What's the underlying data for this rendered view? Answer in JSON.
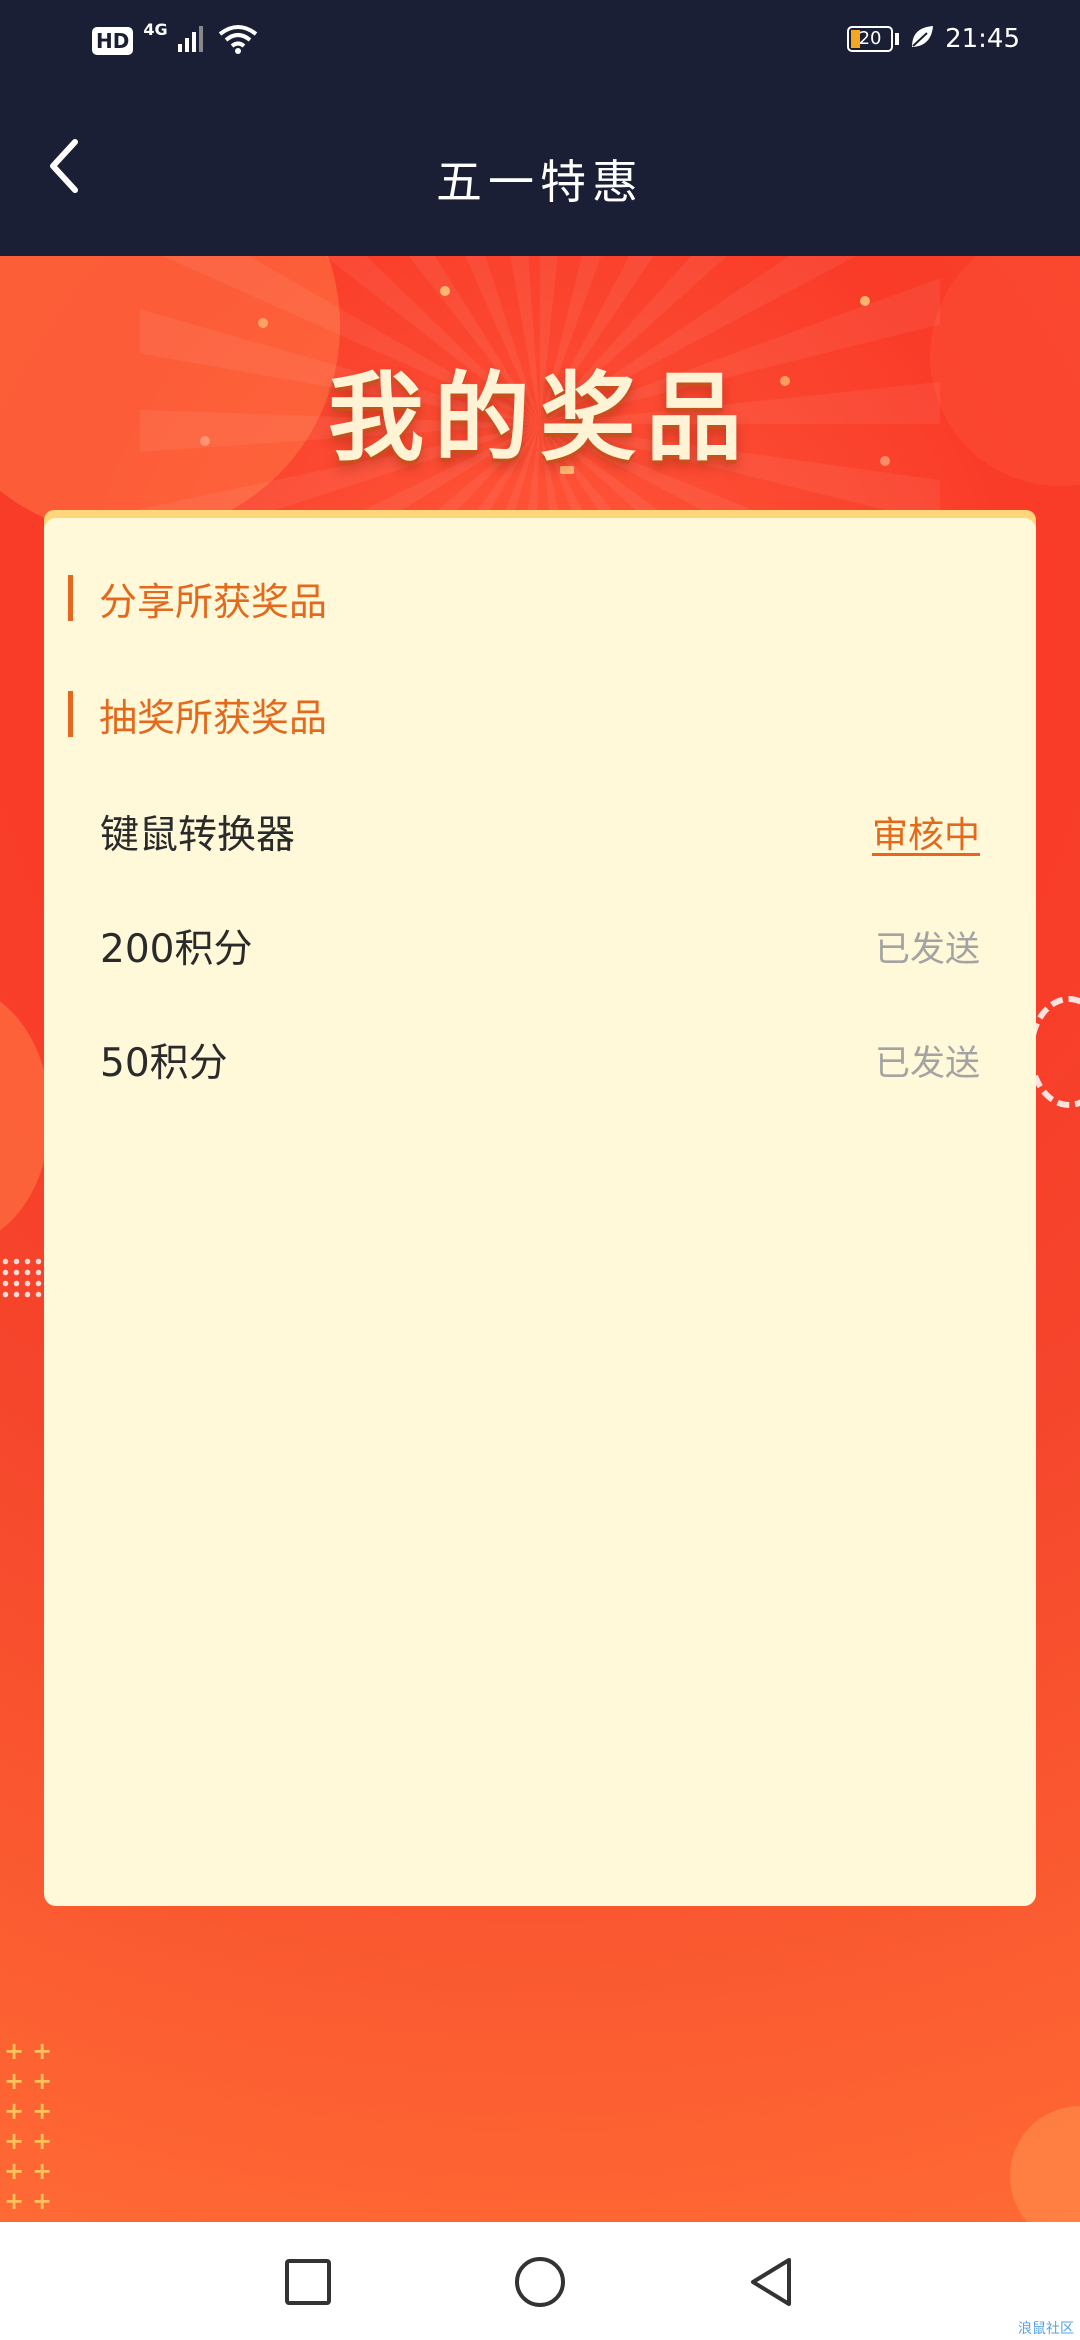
{
  "status_bar": {
    "hd_label": "HD",
    "network_label": "4G",
    "battery_text": "20",
    "time": "21:45",
    "icons": [
      "signal-icon",
      "wifi-icon",
      "battery-icon",
      "leaf-icon"
    ]
  },
  "header": {
    "title": "五一特惠",
    "back_icon": "chevron-left-icon"
  },
  "banner": {
    "title": "我的奖品"
  },
  "sections": {
    "share_label": "分享所获奖品",
    "lottery_label": "抽奖所获奖品"
  },
  "prizes": [
    {
      "name": "键鼠转换器",
      "status": "审核中"
    },
    {
      "name": "200积分",
      "status": "已发送"
    },
    {
      "name": "50积分",
      "status": "已发送"
    }
  ],
  "nav": {
    "icons": [
      "recents-square-icon",
      "home-circle-icon",
      "back-triangle-icon"
    ]
  },
  "watermark": "浪鼠社区",
  "colors": {
    "header_bg": "#1b1f36",
    "accent_orange": "#e36a1d",
    "card_bg": "#fff8d9",
    "banner_red": "#f93b28"
  }
}
